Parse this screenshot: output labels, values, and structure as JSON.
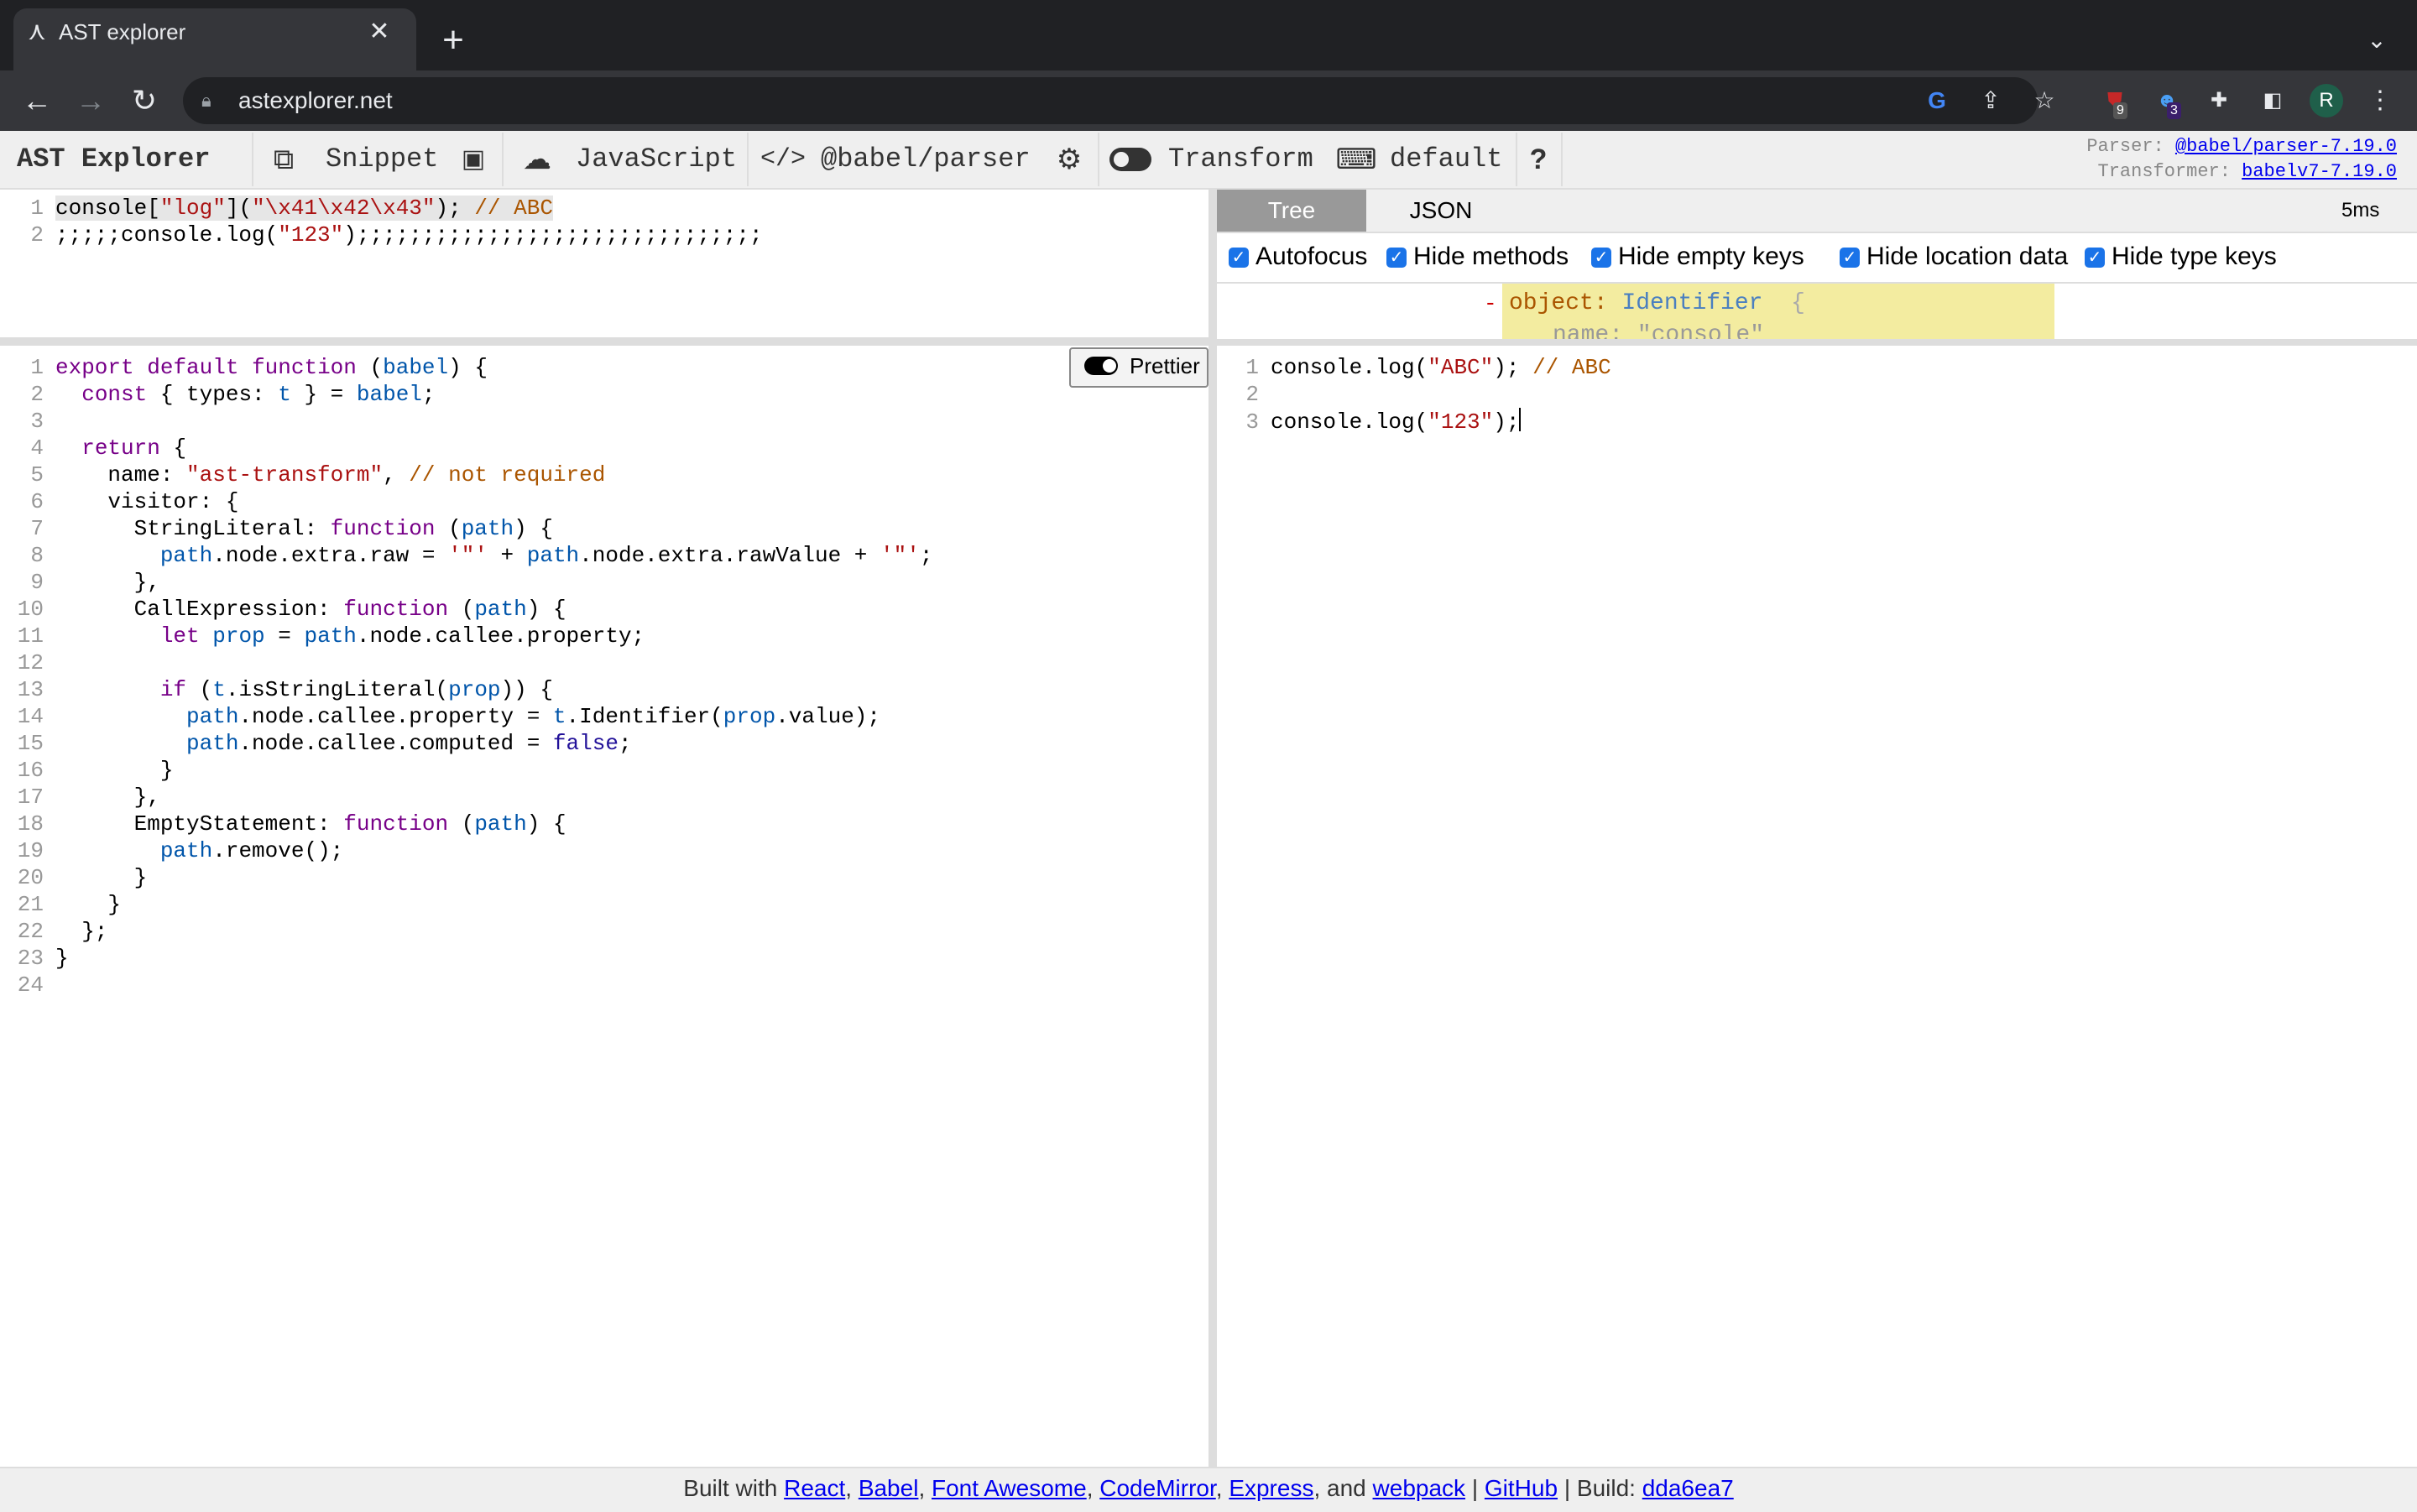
{
  "browser": {
    "tab_title": "AST explorer",
    "url": "astexplorer.net",
    "extensions": {
      "badge1": "9",
      "badge2": "3"
    },
    "avatar_letter": "R"
  },
  "toolbar": {
    "app_title": "AST Explorer",
    "snippet": "Snippet",
    "language": "JavaScript",
    "parser": "@babel/parser",
    "transform": "Transform",
    "keymap": "default",
    "parser_label": "Parser:",
    "parser_link": "@babel/parser-7.19.0",
    "transformer_label": "Transformer:",
    "transformer_link": "babelv7-7.19.0"
  },
  "source_code": [
    "console[\"log\"](\"\\x41\\x42\\x43\"); // ABC",
    ";;;;;console.log(\"123\");;;;;;;;;;;;;;;;;;;;;;;;;;;;;;;"
  ],
  "transform_code": [
    "export default function (babel) {",
    "  const { types: t } = babel;",
    "",
    "  return {",
    "    name: \"ast-transform\", // not required",
    "    visitor: {",
    "      StringLiteral: function (path) {",
    "        path.node.extra.raw = '\"' + path.node.extra.rawValue + '\"';",
    "      },",
    "      CallExpression: function (path) {",
    "        let prop = path.node.callee.property;",
    "",
    "        if (t.isStringLiteral(prop)) {",
    "          path.node.callee.property = t.Identifier(prop.value);",
    "          path.node.callee.computed = false;",
    "        }",
    "      },",
    "      EmptyStatement: function (path) {",
    "        path.remove();",
    "      }",
    "    }",
    "  };",
    "}",
    ""
  ],
  "output_code": [
    "console.log(\"ABC\"); // ABC",
    "",
    "console.log(\"123\");"
  ],
  "ast_panel": {
    "tabs": [
      "Tree",
      "JSON"
    ],
    "active_tab": "Tree",
    "time": "5ms",
    "options": [
      {
        "label": "Autofocus",
        "checked": true
      },
      {
        "label": "Hide methods",
        "checked": true
      },
      {
        "label": "Hide empty keys",
        "checked": true
      },
      {
        "label": "Hide location data",
        "checked": true
      },
      {
        "label": "Hide type keys",
        "checked": true
      }
    ],
    "tree_key": "object:",
    "tree_type": "Identifier",
    "tree_brace": "{",
    "tree_next": "name: \"console\""
  },
  "prettier_label": "Prettier",
  "footer": {
    "prefix": "Built with",
    "links": [
      "React",
      "Babel",
      "Font Awesome",
      "CodeMirror",
      "Express",
      "webpack"
    ],
    "and": "and",
    "github": "GitHub",
    "build_label": "Build:",
    "build_hash": "dda6ea7"
  },
  "colors": {
    "keyword": "#770088",
    "string": "#aa1111",
    "comment": "#aa5500",
    "variable": "#0055aa",
    "tab_active_bg": "#999999"
  }
}
